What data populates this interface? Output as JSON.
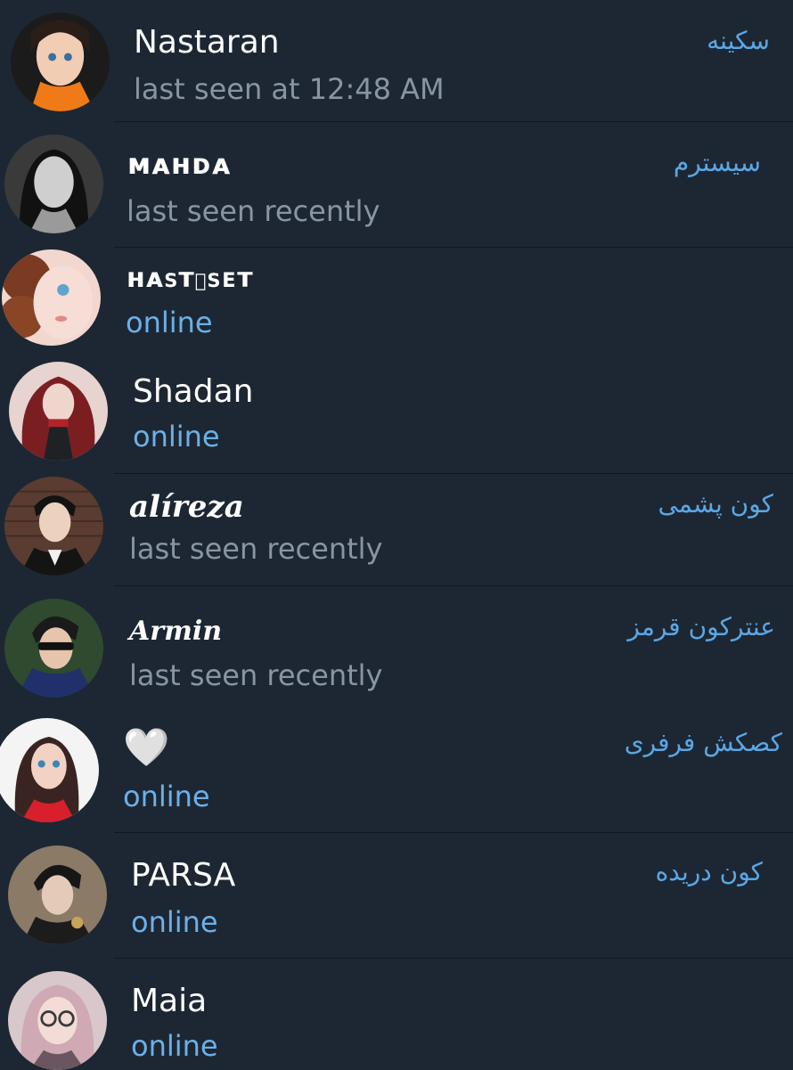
{
  "contacts": [
    {
      "name": "Nastaran",
      "status": "last seen at 12:48 AM",
      "nickname": "سکینه",
      "online": false
    },
    {
      "name": "ᴍᴀʜᴅᴀ",
      "status": "last seen recently",
      "nickname": "سیسترم",
      "online": false
    },
    {
      "name": "ʜᴀsᴛɪsᴇᴛ",
      "status": "online",
      "nickname": "",
      "online": true
    },
    {
      "name": "Shadan",
      "status": "online",
      "nickname": "",
      "online": true
    },
    {
      "name": "alíreza",
      "status": "last seen recently",
      "nickname": "کون پشمی",
      "online": false
    },
    {
      "name": "Armin",
      "status": "last seen recently",
      "nickname": "عنترکون قرمز",
      "online": false
    },
    {
      "name": "🤍",
      "status": "online",
      "nickname": "کصکش فرفری",
      "online": true
    },
    {
      "name": "PARSA",
      "status": "online",
      "nickname": "کون دریده",
      "online": true
    },
    {
      "name": "Maia",
      "status": "online",
      "nickname": "",
      "online": true
    }
  ],
  "colors": {
    "background": "#1d2733",
    "divider": "#101820",
    "name": "#ffffff",
    "status_offline": "#8a95a2",
    "status_online": "#6cb0e8",
    "nickname": "#5ba7e4"
  },
  "icons": {
    "avatar": "avatar-image"
  }
}
